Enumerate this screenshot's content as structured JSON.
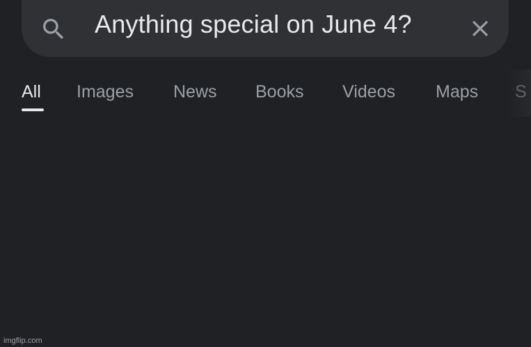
{
  "search": {
    "query": "Anything special on June 4?",
    "search_icon": "search-icon",
    "clear_icon": "close-icon"
  },
  "tabs": [
    {
      "label": "All",
      "active": true
    },
    {
      "label": "Images",
      "active": false
    },
    {
      "label": "News",
      "active": false
    },
    {
      "label": "Books",
      "active": false
    },
    {
      "label": "Videos",
      "active": false
    },
    {
      "label": "Maps",
      "active": false
    },
    {
      "label": "S",
      "active": false
    }
  ],
  "watermark": "imgflip.com",
  "colors": {
    "background": "#202124",
    "search_bar": "#303134",
    "text_primary": "#e8eaed",
    "text_secondary": "#9aa0a6"
  }
}
